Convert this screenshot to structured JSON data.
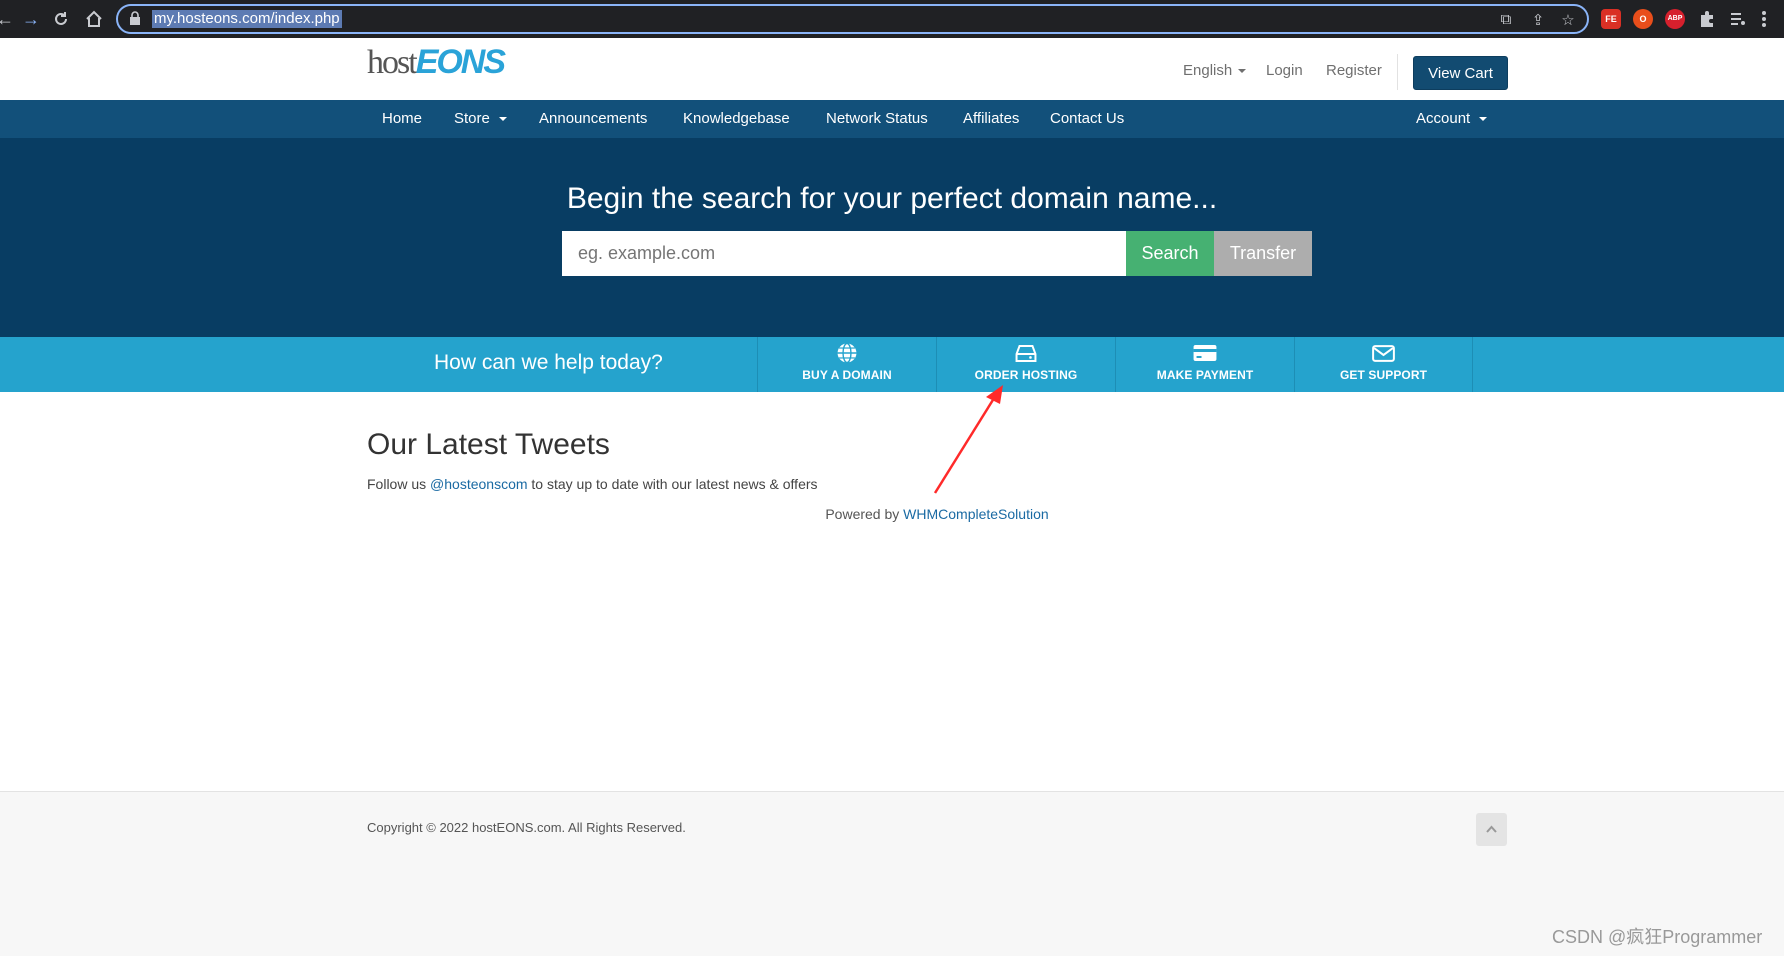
{
  "browser": {
    "url": "my.hosteons.com/index.php",
    "extensions": [
      "FE",
      "O",
      "ABP"
    ]
  },
  "header": {
    "logo_host": "host",
    "logo_eons": "EONS",
    "language": "English",
    "login": "Login",
    "register": "Register",
    "view_cart": "View Cart"
  },
  "nav": {
    "items": [
      "Home",
      "Store",
      "Announcements",
      "Knowledgebase",
      "Network Status",
      "Affiliates",
      "Contact Us"
    ],
    "account": "Account"
  },
  "hero": {
    "title": "Begin the search for your perfect domain name...",
    "search_placeholder": "eg. example.com",
    "search_label": "Search",
    "transfer_label": "Transfer"
  },
  "help": {
    "title": "How can we help today?",
    "items": [
      {
        "label": "BUY A DOMAIN",
        "icon": "globe-icon"
      },
      {
        "label": "ORDER HOSTING",
        "icon": "server-icon"
      },
      {
        "label": "MAKE PAYMENT",
        "icon": "credit-card-icon"
      },
      {
        "label": "GET SUPPORT",
        "icon": "envelope-icon"
      }
    ]
  },
  "tweets": {
    "title": "Our Latest Tweets",
    "follow_prefix": "Follow us ",
    "handle": "@hosteonscom",
    "follow_suffix": " to stay up to date with our latest news & offers"
  },
  "powered": {
    "prefix": "Powered by ",
    "link": "WHMCompleteSolution"
  },
  "footer": {
    "copyright": "Copyright © 2022 hostEONS.com. All Rights Reserved."
  },
  "watermark": "CSDN @疯狂Programmer",
  "colors": {
    "navbar": "#12507a",
    "hero": "#083d63",
    "helpbar": "#25a3cd",
    "search": "#46b172",
    "annotation_arrow": "#ff2a2a"
  }
}
